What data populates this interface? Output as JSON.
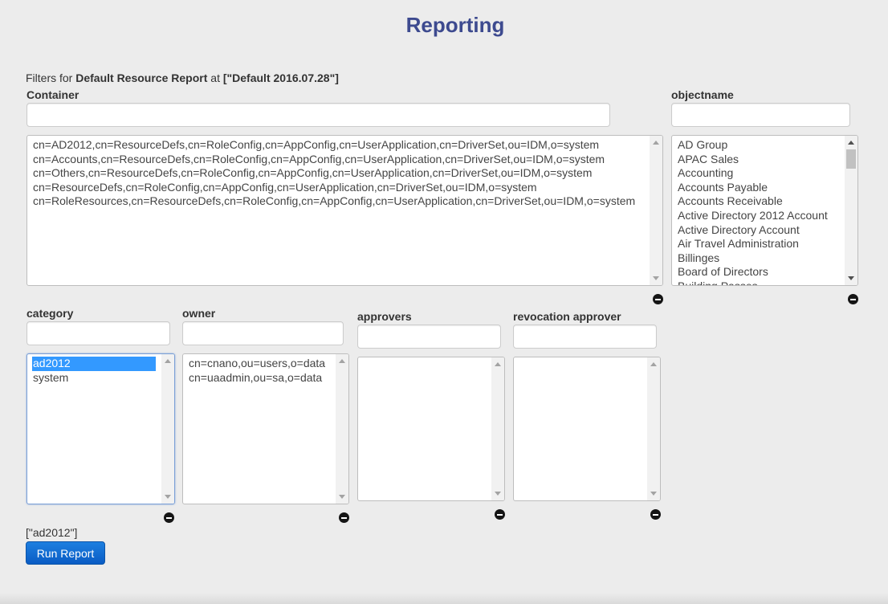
{
  "page": {
    "title": "Reporting"
  },
  "filters": {
    "prefix": "Filters for ",
    "report_name": "Default Resource Report",
    "middle": " at ",
    "version": "[\"Default 2016.07.28\"]"
  },
  "container": {
    "label": "Container",
    "search_value": "",
    "options": [
      "cn=AD2012,cn=ResourceDefs,cn=RoleConfig,cn=AppConfig,cn=UserApplication,cn=DriverSet,ou=IDM,o=system",
      "cn=Accounts,cn=ResourceDefs,cn=RoleConfig,cn=AppConfig,cn=UserApplication,cn=DriverSet,ou=IDM,o=system",
      "cn=Others,cn=ResourceDefs,cn=RoleConfig,cn=AppConfig,cn=UserApplication,cn=DriverSet,ou=IDM,o=system",
      "cn=ResourceDefs,cn=RoleConfig,cn=AppConfig,cn=UserApplication,cn=DriverSet,ou=IDM,o=system",
      "cn=RoleResources,cn=ResourceDefs,cn=RoleConfig,cn=AppConfig,cn=UserApplication,cn=DriverSet,ou=IDM,o=system"
    ]
  },
  "objectname": {
    "label": "objectname",
    "search_value": "",
    "options": [
      "AD Group",
      "APAC Sales",
      "Accounting",
      "Accounts Payable",
      "Accounts Receivable",
      "Active Directory 2012 Account",
      "Active Directory Account",
      "Air Travel Administration",
      "Billinges",
      "Board of Directors",
      "Building Passes"
    ]
  },
  "category": {
    "label": "category",
    "search_value": "",
    "options": [
      "ad2012",
      "system"
    ],
    "selected": "ad2012"
  },
  "owner": {
    "label": "owner",
    "search_value": "",
    "options": [
      "cn=cnano,ou=users,o=data",
      "cn=uaadmin,ou=sa,o=data"
    ]
  },
  "approvers": {
    "label": "approvers",
    "search_value": "",
    "options": []
  },
  "revocation_approver": {
    "label": "revocation approver",
    "search_value": "",
    "options": []
  },
  "result": {
    "text": "[\"ad2012\"]"
  },
  "run_button": {
    "label": "Run Report"
  },
  "colors": {
    "title": "#3d4a8f",
    "button": "#0a5cc4",
    "selection": "#3399ff"
  }
}
